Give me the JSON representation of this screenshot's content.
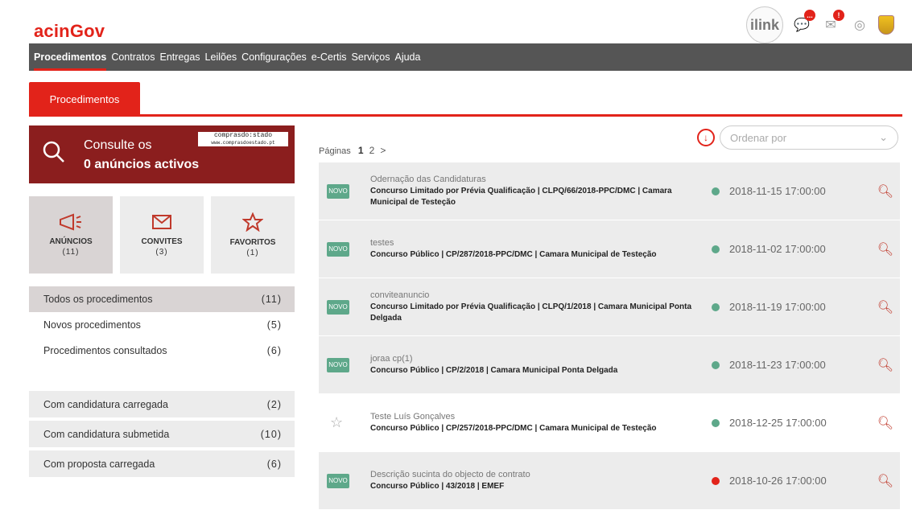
{
  "app": {
    "logo_prefix": "acin",
    "logo_suffix": "Gov"
  },
  "top_icons": {
    "ilink": "ilink",
    "badge1": "...",
    "badge2": "!"
  },
  "nav": [
    "Procedimentos",
    "Contratos",
    "Entregas",
    "Leilões",
    "Configurações",
    "e-Certis",
    "Serviços",
    "Ajuda"
  ],
  "tab": {
    "label": "Procedimentos"
  },
  "search": {
    "line1": "Consulte os",
    "line2": "0 anúncios activos",
    "brand_top": "comprasdo:stado",
    "brand_bottom": "www.comprasdoestado.pt"
  },
  "tiles": [
    {
      "label": "ANÚNCIOS",
      "count": "(11)",
      "icon": "megaphone-icon"
    },
    {
      "label": "CONVITES",
      "count": "(3)",
      "icon": "envelope-icon"
    },
    {
      "label": "FAVORITOS",
      "count": "(1)",
      "icon": "star-icon"
    }
  ],
  "filters": [
    {
      "label": "Todos os procedimentos",
      "count": "(11)"
    },
    {
      "label": "Novos procedimentos",
      "count": "(5)"
    },
    {
      "label": "Procedimentos consultados",
      "count": "(6)"
    }
  ],
  "statuses": [
    {
      "label": "Com candidatura carregada",
      "count": "(2)"
    },
    {
      "label": "Com candidatura submetida",
      "count": "(10)"
    },
    {
      "label": "Com proposta carregada",
      "count": "(6)"
    }
  ],
  "pagination": {
    "label": "Páginas",
    "current": "1",
    "next": "2",
    "arrow": ">"
  },
  "sort": {
    "placeholder": "Ordenar por",
    "download_icon": "download-icon"
  },
  "procedures": [
    {
      "badge": "NOVO",
      "sub": "Odernação das Candidaturas",
      "title": "Concurso Limitado por Prévia Qualificação | CLPQ/66/2018-PPC/DMC | Camara Municipal de Testeção",
      "date": "2018-11-15 17:00:00",
      "dot_color": "#5ea88a"
    },
    {
      "badge": "NOVO",
      "sub": "testes",
      "title": "Concurso Público | CP/287/2018-PPC/DMC | Camara Municipal de Testeção",
      "date": "2018-11-02 17:00:00",
      "dot_color": "#5ea88a"
    },
    {
      "badge": "NOVO",
      "sub": "conviteanuncio",
      "title": "Concurso Limitado por Prévia Qualificação | CLPQ/1/2018 | Camara Municipal Ponta Delgada",
      "date": "2018-11-19 17:00:00",
      "dot_color": "#5ea88a"
    },
    {
      "badge": "NOVO",
      "sub": "joraa cp(1)",
      "title": "Concurso Público | CP/2/2018 | Camara Municipal Ponta Delgada",
      "date": "2018-11-23 17:00:00",
      "dot_color": "#5ea88a"
    },
    {
      "badge": "",
      "sub": "Teste Luís Gonçalves",
      "title": "Concurso Público | CP/257/2018-PPC/DMC | Camara Municipal de Testeção",
      "date": "2018-12-25 17:00:00",
      "dot_color": "#5ea88a"
    },
    {
      "badge": "NOVO",
      "sub": "Descrição sucinta do objecto de contrato",
      "title": "Concurso Público | 43/2018 | EMEF",
      "date": "2018-10-26 17:00:00",
      "dot_color": "#e2231a"
    }
  ]
}
